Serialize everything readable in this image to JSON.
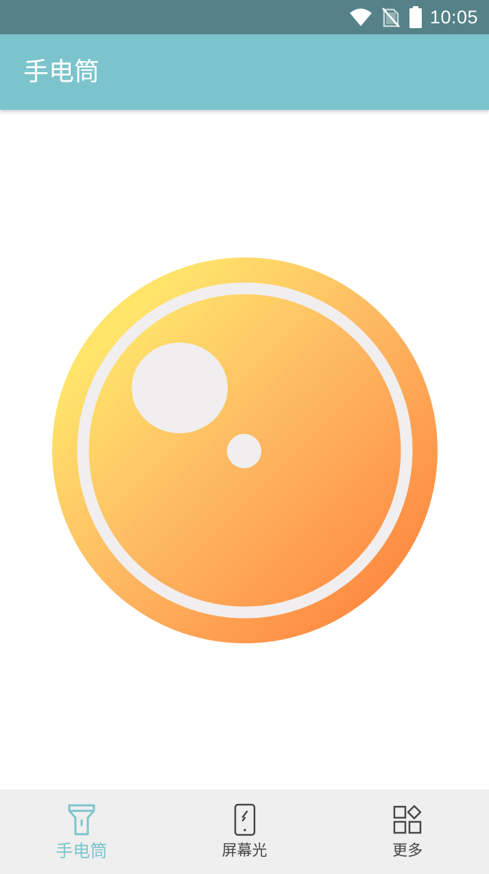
{
  "status_bar": {
    "time": "10:05",
    "icons": [
      "wifi-icon",
      "no-sim-icon",
      "battery-icon"
    ]
  },
  "app_bar": {
    "title": "手电筒"
  },
  "main": {
    "flash_button_icon": "flashlight-lens-icon"
  },
  "bottom_nav": {
    "active_index": 0,
    "items": [
      {
        "label": "手电筒",
        "icon": "flashlight-icon"
      },
      {
        "label": "屏幕光",
        "icon": "phone-screen-icon"
      },
      {
        "label": "更多",
        "icon": "more-apps-icon"
      }
    ]
  },
  "colors": {
    "status_bar": "#548288",
    "app_bar": "#7cc4cc",
    "accent": "#7cc4cc",
    "gradient_start": "#ffe46a",
    "gradient_end": "#ff7e3a",
    "ring": "#f0eeee",
    "nav_background": "#efefef",
    "nav_inactive": "#454545"
  }
}
